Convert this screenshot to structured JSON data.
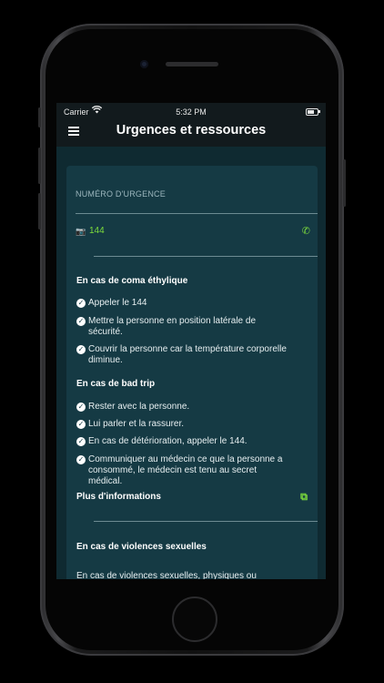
{
  "status_bar": {
    "carrier": "Carrier",
    "time": "5:32 PM"
  },
  "navbar": {
    "title": "Urgences et ressources",
    "menu_icon": "hamburger-menu-icon"
  },
  "emergency": {
    "label": "NUMÉRO D'URGENCE",
    "number": "144",
    "number_icon": "camera-icon",
    "call_icon": "phone-icon"
  },
  "sections": [
    {
      "title": "En cas de coma éthylique",
      "items": [
        "Appeler le 144",
        "Mettre la personne en position latérale de sécurité.",
        "Couvrir la personne car la température corporelle diminue."
      ]
    },
    {
      "title": "En cas de bad trip",
      "items": [
        "Rester avec la personne.",
        "Lui parler et la rassurer.",
        "En cas de détérioration, appeler le 144.",
        "Communiquer au médecin ce que la personne a consommé, le médecin est tenu au secret médical."
      ]
    }
  ],
  "more_info": {
    "label": "Plus d'informations",
    "icon": "external-link-icon"
  },
  "violence": {
    "title": "En cas de violences sexuelles",
    "text": "En cas de violences sexuelles, physiques ou"
  },
  "colors": {
    "accent": "#7ddc3c",
    "card": "#153a44",
    "background": "#0f2a31"
  }
}
